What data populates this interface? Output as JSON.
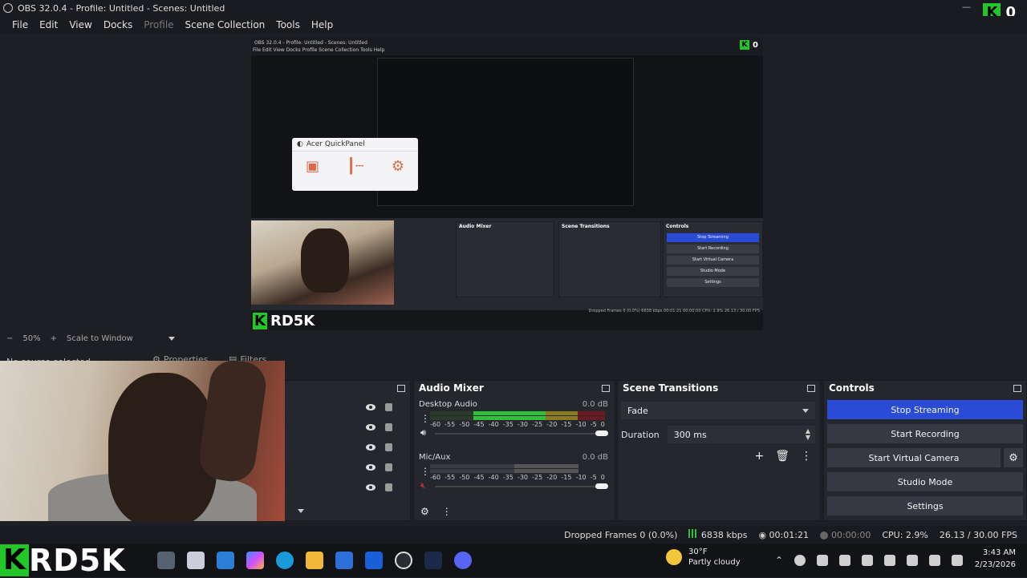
{
  "window": {
    "title": "OBS 32.0.4 - Profile: Untitled - Scenes: Untitled",
    "kbadge_letter": "K",
    "kbadge_count": "0"
  },
  "menu": [
    "File",
    "Edit",
    "View",
    "Docks",
    "Profile",
    "Scene Collection",
    "Tools",
    "Help"
  ],
  "preview": {
    "nested_title": "OBS 32.0.4 - Profile: Untitled - Scenes: Untitled",
    "nested_menu": "File   Edit   View   Docks   Profile   Scene Collection   Tools   Help",
    "acer_title": "Acer QuickPanel",
    "nested_brand": "RD5K",
    "nested_status": "Dropped Frames 0 (0.0%)   6838 kbps   00:01:21   00:00:00   CPU: 2.9%   26.13 / 30.00 FPS",
    "nested_panels": {
      "mixer_title": "Audio Mixer",
      "transitions_title": "Scene Transitions",
      "controls_title": "Controls",
      "buttons": [
        "Stop Streaming",
        "Start Recording",
        "Start Virtual Camera",
        "Studio Mode",
        "Settings"
      ]
    }
  },
  "zoom": {
    "minus": "−",
    "value": "50%",
    "plus": "+",
    "mode": "Scale to Window"
  },
  "source_bar": {
    "status": "No source selected",
    "properties": "Properties",
    "filters": "Filters"
  },
  "audio_mixer": {
    "title": "Audio Mixer",
    "tracks": [
      {
        "name": "Desktop Audio",
        "db": "0.0 dB",
        "muted": false
      },
      {
        "name": "Mic/Aux",
        "db": "0.0 dB",
        "muted": true
      }
    ],
    "scale": [
      "-60",
      "-55",
      "-50",
      "-45",
      "-40",
      "-35",
      "-30",
      "-25",
      "-20",
      "-15",
      "-10",
      "-5",
      "0"
    ]
  },
  "scene_transitions": {
    "title": "Scene Transitions",
    "transition": "Fade",
    "duration_label": "Duration",
    "duration_value": "300 ms"
  },
  "controls": {
    "title": "Controls",
    "stop_streaming": "Stop Streaming",
    "start_recording": "Start Recording",
    "start_virtual_camera": "Start Virtual Camera",
    "studio_mode": "Studio Mode",
    "settings": "Settings"
  },
  "status": {
    "dropped_frames": "Dropped Frames 0 (0.0%)",
    "bitrate": "6838 kbps",
    "stream_time": "00:01:21",
    "record_time": "00:00:00",
    "cpu": "CPU: 2.9%",
    "fps": "26.13 / 30.00 FPS"
  },
  "taskbar": {
    "brand_letter": "K",
    "brand_text": "RD5K",
    "weather_temp": "30°F",
    "weather_desc": "Partly cloudy",
    "time": "3:43 AM",
    "date": "2/23/2026"
  },
  "colors": {
    "accent_blue": "#2a4bd6",
    "brand_green": "#22c52a",
    "meter_green": "#2fbf3a",
    "meter_yellow": "#c9a227",
    "meter_red": "#b3222c"
  }
}
